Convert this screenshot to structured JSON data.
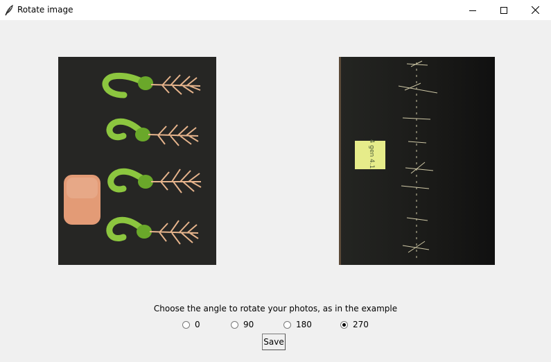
{
  "window": {
    "title": "Rotate image"
  },
  "caption": "Choose the angle to rotate your photos, as in the example",
  "rotation": {
    "options": [
      "0",
      "90",
      "180",
      "270"
    ],
    "selected": "270"
  },
  "save_button": {
    "label": "Save"
  },
  "example_image": {
    "icon": "sprouting-seeds-illustration"
  },
  "photo_image": {
    "icon": "seedlings-photo",
    "note_text": "4 gen 4.1"
  },
  "colors": {
    "titlebar_bg": "#ffffff",
    "window_bg": "#f0f0f0",
    "example_bg": "#262624",
    "photo_bg": "#1b1b19",
    "sprout_green": "#8cc63f",
    "root_color": "#e6b48c",
    "tag_color": "#e39b76",
    "sticky_note": "#e6ec8a"
  }
}
